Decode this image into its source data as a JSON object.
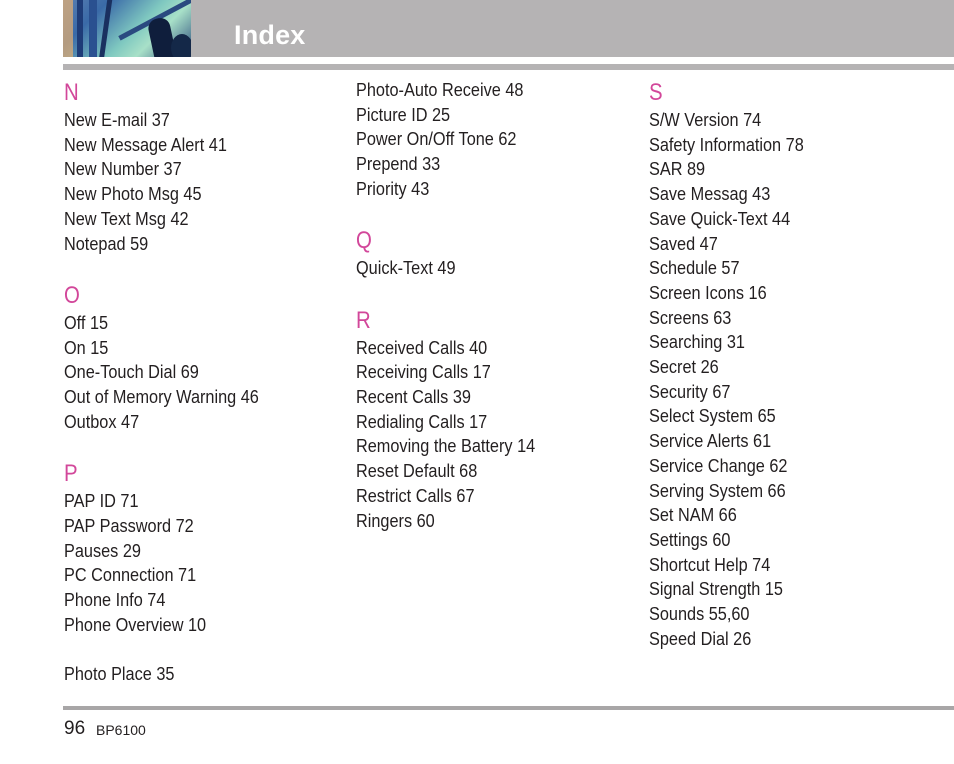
{
  "header": {
    "title": "Index",
    "photo": "header-photo"
  },
  "accent_color": "#d2479a",
  "columns": [
    {
      "sections": [
        {
          "letter": "N",
          "entries": [
            "New E-mail 37",
            "New Message Alert 41",
            "New Number 37",
            "New Photo Msg 45",
            "New Text Msg 42",
            "Notepad 59"
          ]
        },
        {
          "letter": "O",
          "entries": [
            "Off 15",
            "On 15",
            "One-Touch Dial 69",
            "Out of Memory Warning 46",
            "Outbox 47"
          ]
        },
        {
          "letter": "P",
          "entries": [
            "PAP ID 71",
            "PAP Password 72",
            "Pauses 29",
            "PC Connection 71",
            "Phone Info 74",
            "Phone Overview 10",
            "",
            "Photo Place 35"
          ]
        }
      ]
    },
    {
      "sections": [
        {
          "letter": "",
          "entries": [
            "Photo-Auto Receive 48",
            "Picture ID 25",
            "Power On/Off Tone 62",
            "Prepend 33",
            "Priority 43"
          ]
        },
        {
          "letter": "Q",
          "entries": [
            "Quick-Text 49"
          ]
        },
        {
          "letter": "R",
          "entries": [
            "Received Calls 40",
            "Receiving Calls 17",
            "Recent Calls 39",
            "Redialing Calls 17",
            "Removing the Battery 14",
            "Reset Default 68",
            "Restrict Calls 67",
            "Ringers 60"
          ]
        }
      ]
    },
    {
      "sections": [
        {
          "letter": "S",
          "entries": [
            "S/W Version 74",
            "Safety Information 78",
            "SAR 89",
            "Save Messag 43",
            "Save Quick-Text 44",
            "Saved 47",
            "Schedule 57",
            "Screen Icons 16",
            "Screens 63",
            "Searching 31",
            "Secret 26",
            "Security 67",
            "Select System 65",
            "Service Alerts 61",
            "Service Change 62",
            "Serving System 66",
            "Set NAM 66",
            "Settings 60",
            "Shortcut Help 74",
            "Signal Strength 15",
            "Sounds 55,60",
            "Speed Dial 26"
          ]
        }
      ]
    }
  ],
  "footer": {
    "page_number": "96",
    "model": "BP6100"
  }
}
